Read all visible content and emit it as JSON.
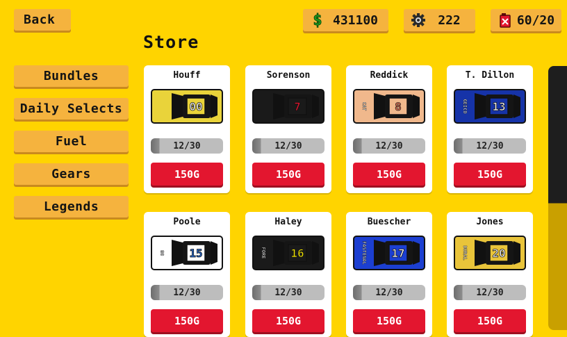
{
  "nav": {
    "back_label": "Back"
  },
  "currencies": {
    "cash": {
      "value": "431100",
      "icon": "dollar-icon",
      "color": "#22A31F"
    },
    "gears": {
      "value": "222",
      "icon": "gear-icon"
    },
    "fuel": {
      "value": "60/20",
      "icon": "fuel-can-icon",
      "color": "#E3162F"
    }
  },
  "store": {
    "title": "Store"
  },
  "sidebar": {
    "items": [
      {
        "label": "Bundles"
      },
      {
        "label": "Daily Selects"
      },
      {
        "label": "Fuel"
      },
      {
        "label": "Gears"
      },
      {
        "label": "Legends"
      }
    ]
  },
  "cards": [
    {
      "name": "Houff",
      "progress": "12/30",
      "price": "150G",
      "number": "00",
      "car_color": "#E9D33A",
      "number_color": "#FFFFFF",
      "side_text": ""
    },
    {
      "name": "Sorenson",
      "progress": "12/30",
      "price": "150G",
      "number": "7",
      "car_color": "#1A1A1A",
      "number_color": "#E3162F",
      "side_text": ""
    },
    {
      "name": "Reddick",
      "progress": "12/30",
      "price": "150G",
      "number": "8",
      "car_color": "#F0B88C",
      "number_color": "#F07A5B",
      "side_text": "CAT"
    },
    {
      "name": "T. Dillon",
      "progress": "12/30",
      "price": "150G",
      "number": "13",
      "car_color": "#1633A8",
      "number_color": "#FFFFFF",
      "side_text": "GEICO"
    },
    {
      "name": "Poole",
      "progress": "12/30",
      "price": "150G",
      "number": "15",
      "car_color": "#FFFFFF",
      "number_color": "#2A6FD6",
      "side_text": "GO"
    },
    {
      "name": "Haley",
      "progress": "12/30",
      "price": "150G",
      "number": "16",
      "car_color": "#1A1A1A",
      "number_color": "#F2E400",
      "side_text": "FORE"
    },
    {
      "name": "Buescher",
      "progress": "12/30",
      "price": "150G",
      "number": "17",
      "car_color": "#1C3FD1",
      "number_color": "#FFFFFF",
      "side_text": "FASTENAL"
    },
    {
      "name": "Jones",
      "progress": "12/30",
      "price": "150G",
      "number": "20",
      "car_color": "#E9C43A",
      "number_color": "#FFFFFF",
      "side_text": "DURAL"
    }
  ]
}
